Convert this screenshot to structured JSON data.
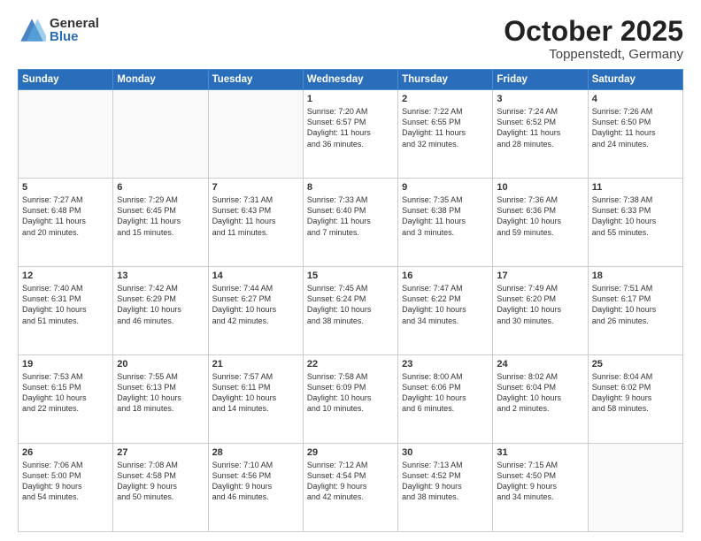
{
  "logo": {
    "general": "General",
    "blue": "Blue"
  },
  "header": {
    "month": "October 2025",
    "location": "Toppenstedt, Germany"
  },
  "weekdays": [
    "Sunday",
    "Monday",
    "Tuesday",
    "Wednesday",
    "Thursday",
    "Friday",
    "Saturday"
  ],
  "weeks": [
    [
      {
        "day": "",
        "info": ""
      },
      {
        "day": "",
        "info": ""
      },
      {
        "day": "",
        "info": ""
      },
      {
        "day": "1",
        "info": "Sunrise: 7:20 AM\nSunset: 6:57 PM\nDaylight: 11 hours\nand 36 minutes."
      },
      {
        "day": "2",
        "info": "Sunrise: 7:22 AM\nSunset: 6:55 PM\nDaylight: 11 hours\nand 32 minutes."
      },
      {
        "day": "3",
        "info": "Sunrise: 7:24 AM\nSunset: 6:52 PM\nDaylight: 11 hours\nand 28 minutes."
      },
      {
        "day": "4",
        "info": "Sunrise: 7:26 AM\nSunset: 6:50 PM\nDaylight: 11 hours\nand 24 minutes."
      }
    ],
    [
      {
        "day": "5",
        "info": "Sunrise: 7:27 AM\nSunset: 6:48 PM\nDaylight: 11 hours\nand 20 minutes."
      },
      {
        "day": "6",
        "info": "Sunrise: 7:29 AM\nSunset: 6:45 PM\nDaylight: 11 hours\nand 15 minutes."
      },
      {
        "day": "7",
        "info": "Sunrise: 7:31 AM\nSunset: 6:43 PM\nDaylight: 11 hours\nand 11 minutes."
      },
      {
        "day": "8",
        "info": "Sunrise: 7:33 AM\nSunset: 6:40 PM\nDaylight: 11 hours\nand 7 minutes."
      },
      {
        "day": "9",
        "info": "Sunrise: 7:35 AM\nSunset: 6:38 PM\nDaylight: 11 hours\nand 3 minutes."
      },
      {
        "day": "10",
        "info": "Sunrise: 7:36 AM\nSunset: 6:36 PM\nDaylight: 10 hours\nand 59 minutes."
      },
      {
        "day": "11",
        "info": "Sunrise: 7:38 AM\nSunset: 6:33 PM\nDaylight: 10 hours\nand 55 minutes."
      }
    ],
    [
      {
        "day": "12",
        "info": "Sunrise: 7:40 AM\nSunset: 6:31 PM\nDaylight: 10 hours\nand 51 minutes."
      },
      {
        "day": "13",
        "info": "Sunrise: 7:42 AM\nSunset: 6:29 PM\nDaylight: 10 hours\nand 46 minutes."
      },
      {
        "day": "14",
        "info": "Sunrise: 7:44 AM\nSunset: 6:27 PM\nDaylight: 10 hours\nand 42 minutes."
      },
      {
        "day": "15",
        "info": "Sunrise: 7:45 AM\nSunset: 6:24 PM\nDaylight: 10 hours\nand 38 minutes."
      },
      {
        "day": "16",
        "info": "Sunrise: 7:47 AM\nSunset: 6:22 PM\nDaylight: 10 hours\nand 34 minutes."
      },
      {
        "day": "17",
        "info": "Sunrise: 7:49 AM\nSunset: 6:20 PM\nDaylight: 10 hours\nand 30 minutes."
      },
      {
        "day": "18",
        "info": "Sunrise: 7:51 AM\nSunset: 6:17 PM\nDaylight: 10 hours\nand 26 minutes."
      }
    ],
    [
      {
        "day": "19",
        "info": "Sunrise: 7:53 AM\nSunset: 6:15 PM\nDaylight: 10 hours\nand 22 minutes."
      },
      {
        "day": "20",
        "info": "Sunrise: 7:55 AM\nSunset: 6:13 PM\nDaylight: 10 hours\nand 18 minutes."
      },
      {
        "day": "21",
        "info": "Sunrise: 7:57 AM\nSunset: 6:11 PM\nDaylight: 10 hours\nand 14 minutes."
      },
      {
        "day": "22",
        "info": "Sunrise: 7:58 AM\nSunset: 6:09 PM\nDaylight: 10 hours\nand 10 minutes."
      },
      {
        "day": "23",
        "info": "Sunrise: 8:00 AM\nSunset: 6:06 PM\nDaylight: 10 hours\nand 6 minutes."
      },
      {
        "day": "24",
        "info": "Sunrise: 8:02 AM\nSunset: 6:04 PM\nDaylight: 10 hours\nand 2 minutes."
      },
      {
        "day": "25",
        "info": "Sunrise: 8:04 AM\nSunset: 6:02 PM\nDaylight: 9 hours\nand 58 minutes."
      }
    ],
    [
      {
        "day": "26",
        "info": "Sunrise: 7:06 AM\nSunset: 5:00 PM\nDaylight: 9 hours\nand 54 minutes."
      },
      {
        "day": "27",
        "info": "Sunrise: 7:08 AM\nSunset: 4:58 PM\nDaylight: 9 hours\nand 50 minutes."
      },
      {
        "day": "28",
        "info": "Sunrise: 7:10 AM\nSunset: 4:56 PM\nDaylight: 9 hours\nand 46 minutes."
      },
      {
        "day": "29",
        "info": "Sunrise: 7:12 AM\nSunset: 4:54 PM\nDaylight: 9 hours\nand 42 minutes."
      },
      {
        "day": "30",
        "info": "Sunrise: 7:13 AM\nSunset: 4:52 PM\nDaylight: 9 hours\nand 38 minutes."
      },
      {
        "day": "31",
        "info": "Sunrise: 7:15 AM\nSunset: 4:50 PM\nDaylight: 9 hours\nand 34 minutes."
      },
      {
        "day": "",
        "info": ""
      }
    ]
  ]
}
